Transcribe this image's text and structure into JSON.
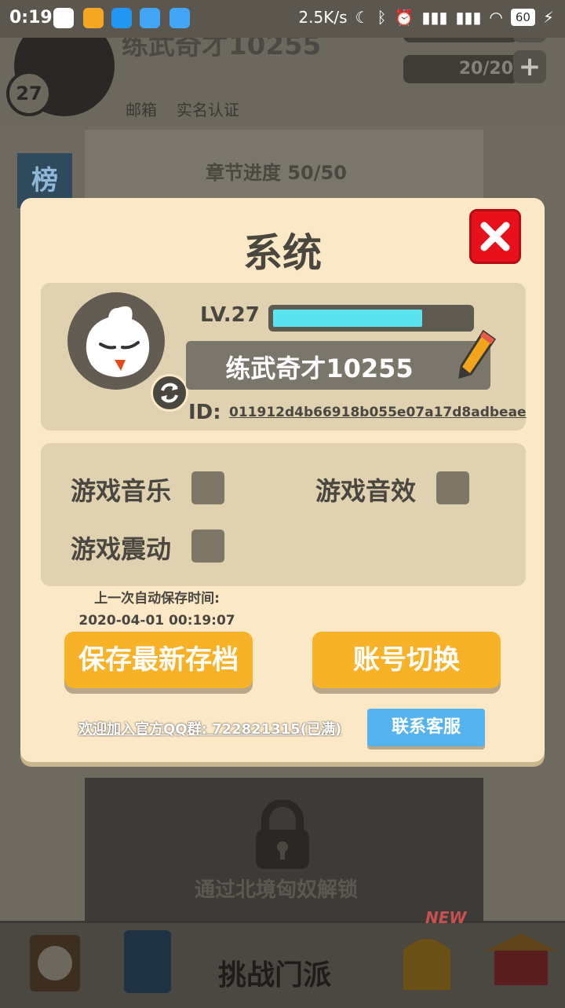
{
  "status_bar": {
    "time": "0:19",
    "net_speed": "2.5K/s",
    "battery": "60"
  },
  "background": {
    "player_name": "练武奇才10255",
    "level_badge": "27",
    "mail_label": "邮箱",
    "realname_label": "实名认证",
    "stamina": "20/20",
    "chapter_progress": "章节进度 50/50",
    "rank_label": "榜",
    "locked_text": "通过北境匈奴解锁",
    "bottom_nav_center": "挑战门派",
    "new_badge": "NEW"
  },
  "dialog": {
    "title": "系统",
    "profile": {
      "level_label": "LV.27",
      "level_progress": 0.76,
      "name": "练武奇才10255",
      "id_label": "ID:",
      "id_value": "011912d4b66918b055e07a17d8adbeae"
    },
    "settings": {
      "music_label": "游戏音乐",
      "sfx_label": "游戏音效",
      "vibration_label": "游戏震动"
    },
    "autosave_label": "上一次自动保存时间:",
    "autosave_time": "2020-04-01 00:19:07",
    "save_button": "保存最新存档",
    "switch_account_button": "账号切换",
    "qq_group_text": "欢迎加入官方QQ群: 722821315(已满)",
    "contact_button": "联系客服"
  },
  "colors": {
    "dialog_bg": "#fae8c6",
    "accent_orange": "#f7b228",
    "close_red": "#e8101a",
    "xp_fill": "#5ae3ef",
    "contact_blue": "#55b4f0"
  }
}
